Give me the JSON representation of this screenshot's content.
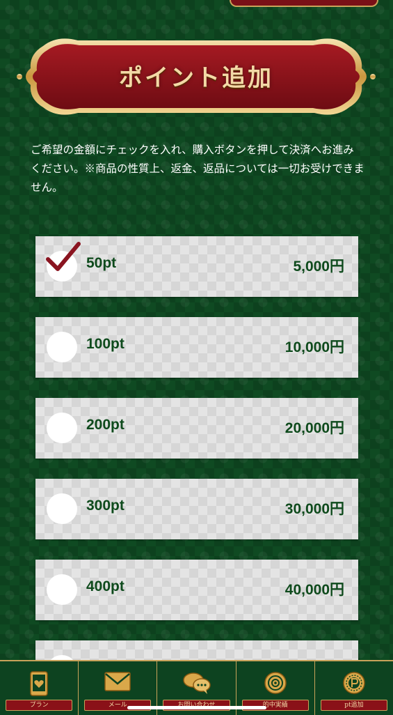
{
  "header": {
    "title": "ポイント追加"
  },
  "intro_text": "ご希望の金額にチェックを入れ、購入ボタンを押して決済へお進みください。※商品の性質上、返金、返品については一切お受けできません。",
  "plans": [
    {
      "name": "50pt",
      "price": "5,000円",
      "selected": true
    },
    {
      "name": "100pt",
      "price": "10,000円",
      "selected": false
    },
    {
      "name": "200pt",
      "price": "20,000円",
      "selected": false
    },
    {
      "name": "300pt",
      "price": "30,000円",
      "selected": false
    },
    {
      "name": "400pt",
      "price": "40,000円",
      "selected": false
    }
  ],
  "bottom_nav": [
    {
      "label": "プラン",
      "icon": "phone-heart-icon"
    },
    {
      "label": "メール",
      "icon": "mail-icon"
    },
    {
      "label": "お問い合わせ",
      "icon": "chat-bubbles-icon"
    },
    {
      "label": "的中実績",
      "icon": "target-icon"
    },
    {
      "label": "pt追加",
      "icon": "point-coin-icon"
    }
  ],
  "colors": {
    "background": "#0f4a22",
    "accent_red": "#8a1118",
    "gold": "#c9a35a",
    "text_green": "#0e4a1c",
    "check_red": "#8a1420"
  }
}
